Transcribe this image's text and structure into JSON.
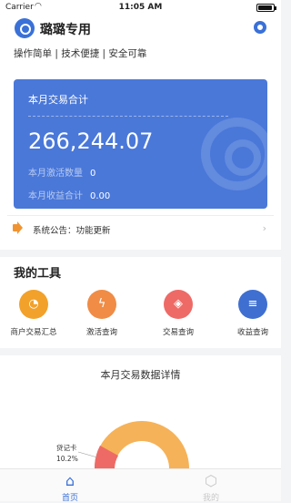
{
  "statusbar": {
    "carrier": "Carrier",
    "time": "11:05 AM"
  },
  "header": {
    "title": "璐璐专用",
    "tagline": "操作简单 | 技术便捷 | 安全可靠"
  },
  "summary_card": {
    "title": "本月交易合计",
    "amount": "266,244.07",
    "activation_label": "本月激活数量",
    "activation_value": "0",
    "income_label": "本月收益合计",
    "income_value": "0.00"
  },
  "notice": {
    "text": "系统公告：功能更新"
  },
  "tools": {
    "heading": "我的工具",
    "items": [
      {
        "label": "商户交易汇总",
        "icon": "pie-icon",
        "color": "#f2a12a"
      },
      {
        "label": "激活查询",
        "icon": "lightning-icon",
        "color": "#f08c46"
      },
      {
        "label": "交易查询",
        "icon": "coin-icon",
        "color": "#ee6a66"
      },
      {
        "label": "收益查询",
        "icon": "database-icon",
        "color": "#3f6fd0"
      }
    ]
  },
  "detail": {
    "heading": "本月交易数据详情",
    "slice_label": "贷记卡",
    "slice_pct": "10.2%",
    "colors": {
      "main": "#f6b258",
      "minor": "#ee6a66"
    }
  },
  "tabbar": {
    "home_label": "首页",
    "other_label": "我的"
  }
}
